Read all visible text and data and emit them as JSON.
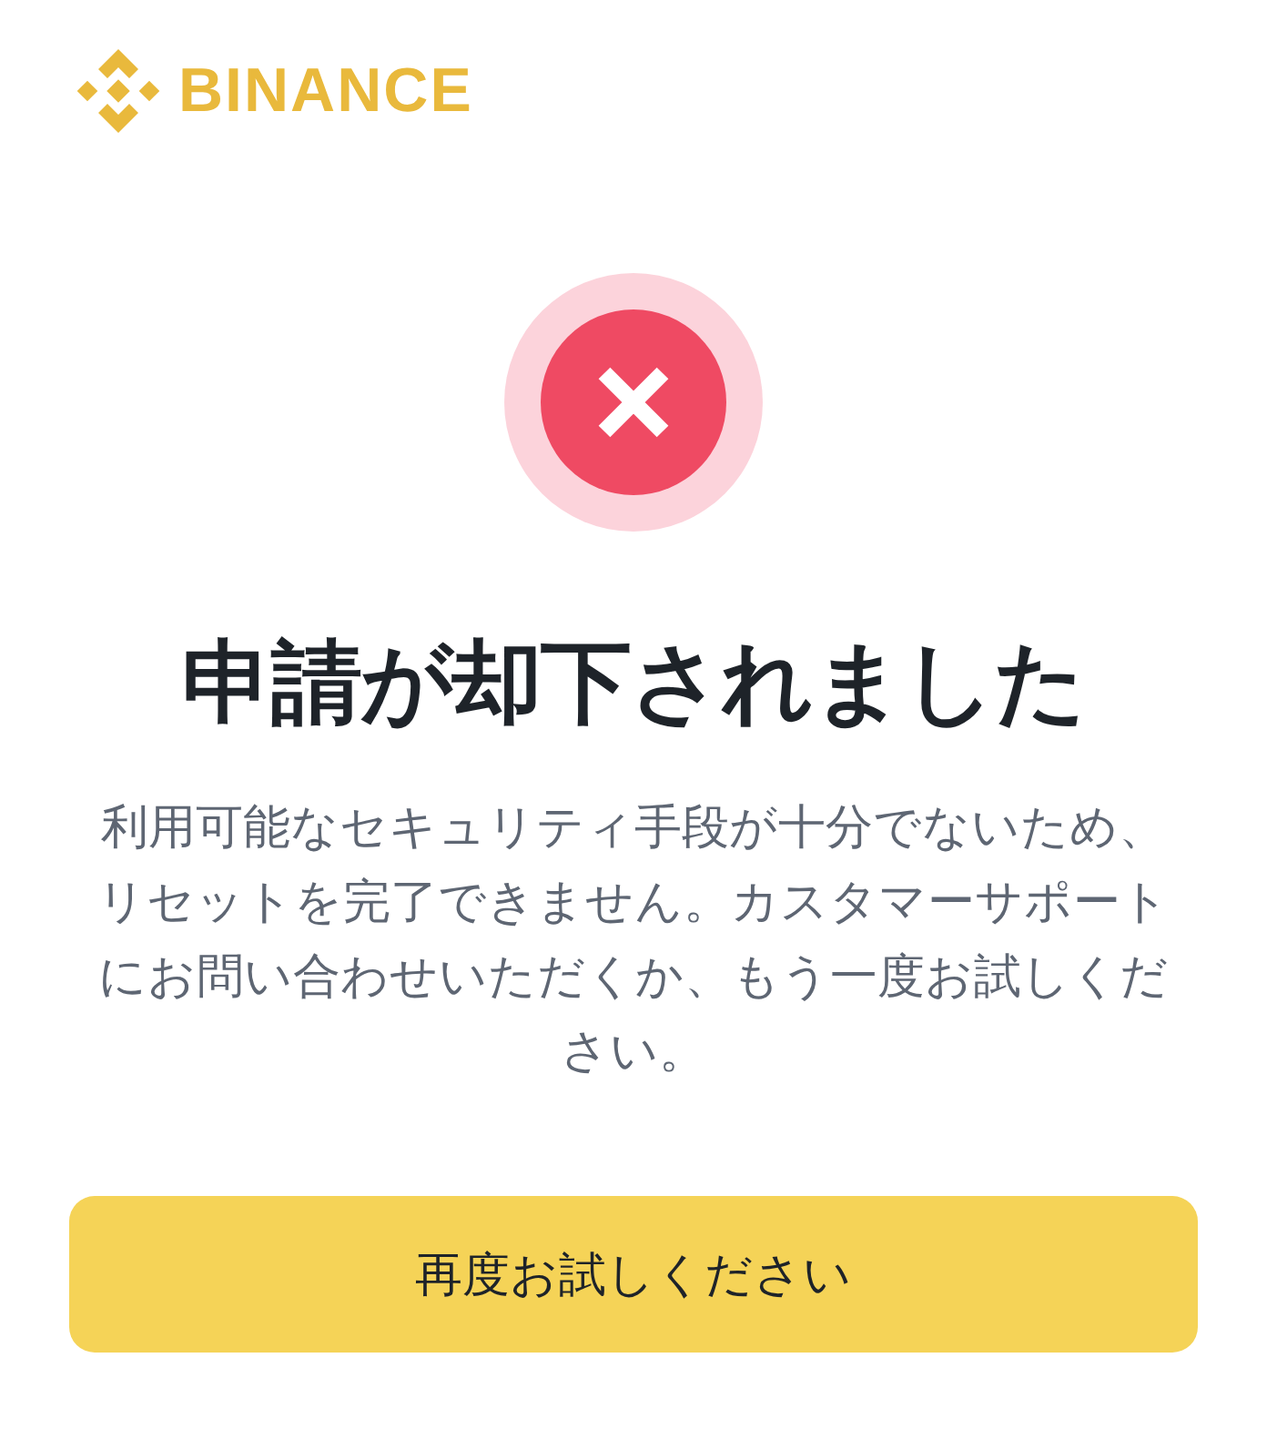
{
  "logo": {
    "text": "BINANCE"
  },
  "status": {
    "kind": "error"
  },
  "title": "申請が却下されました",
  "message": "利用可能なセキュリティ手段が十分でないため、リセットを完了できません。カスタマーサポートにお問い合わせいただくか、もう一度お試しください。",
  "button": {
    "label": "再度お試しください"
  }
}
